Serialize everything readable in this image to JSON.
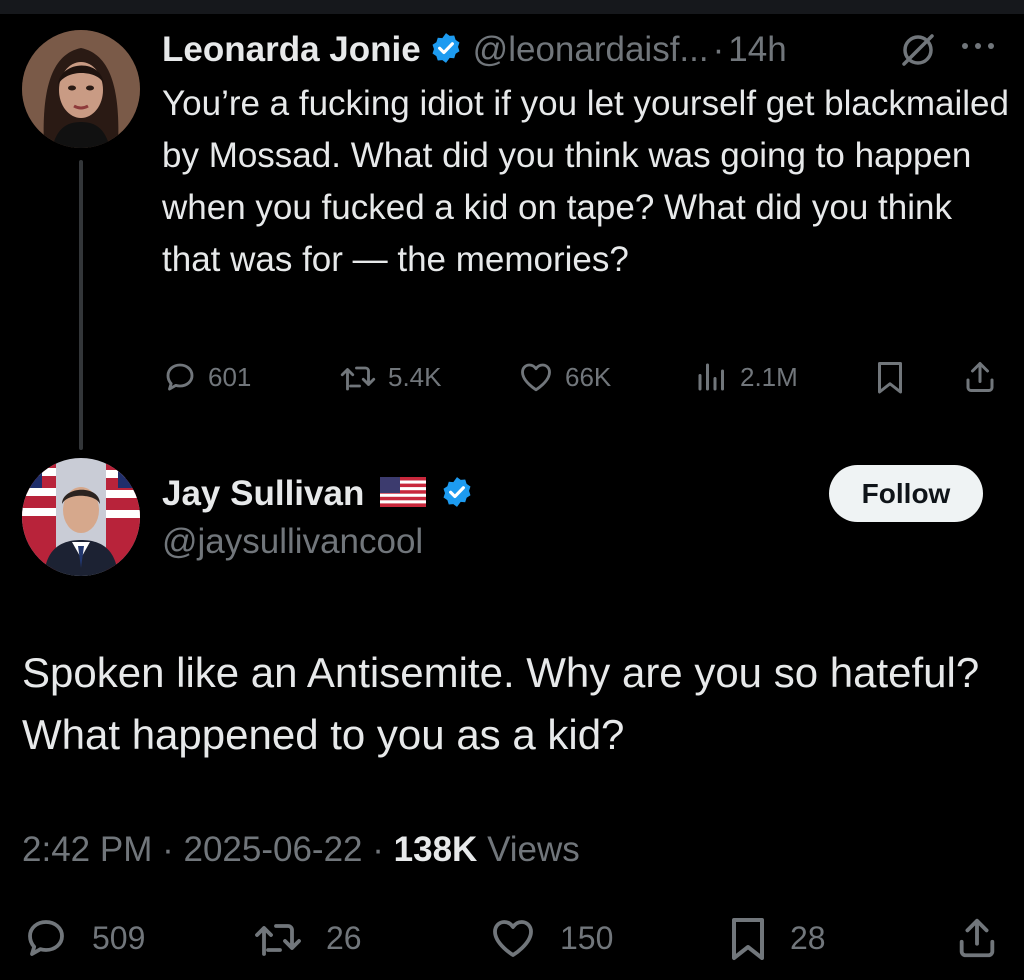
{
  "parent_tweet": {
    "author_name": "Leonarda Jonie",
    "handle": "@leonardaisf...",
    "separator": "·",
    "time": "14h",
    "text": "You’re a fucking idiot if you let yourself get blackmailed by Mossad. What did you think was going to happen when you fucked a kid on tape? What did you think that was for — the memories?",
    "replies": "601",
    "reposts": "5.4K",
    "likes": "66K",
    "views": "2.1M",
    "icons": [
      "grok-icon",
      "more-icon",
      "reply-icon",
      "repost-icon",
      "like-icon",
      "views-icon",
      "bookmark-icon",
      "share-icon"
    ]
  },
  "main_tweet": {
    "author_name": "Jay Sullivan",
    "handle": "@jaysullivancool",
    "follow_label": "Follow",
    "text": "Spoken like an Antisemite. Why are you so hateful? What happened to you as a kid?",
    "time": "2:42 PM",
    "separator": "·",
    "date": "2025-06-22",
    "views_count": "138K",
    "views_label": "Views",
    "replies": "509",
    "reposts": "26",
    "likes": "150",
    "bookmarks": "28",
    "icons": [
      "us-flag-icon",
      "verified-badge-icon",
      "reply-icon",
      "repost-icon",
      "like-icon",
      "bookmark-icon",
      "share-icon"
    ]
  },
  "colors": {
    "background": "#000000",
    "text_primary": "#e7e9ea",
    "text_secondary": "#71767b",
    "verified_blue": "#1d9bf0",
    "follow_button_bg": "#eff3f4",
    "thread_line": "#333639"
  }
}
